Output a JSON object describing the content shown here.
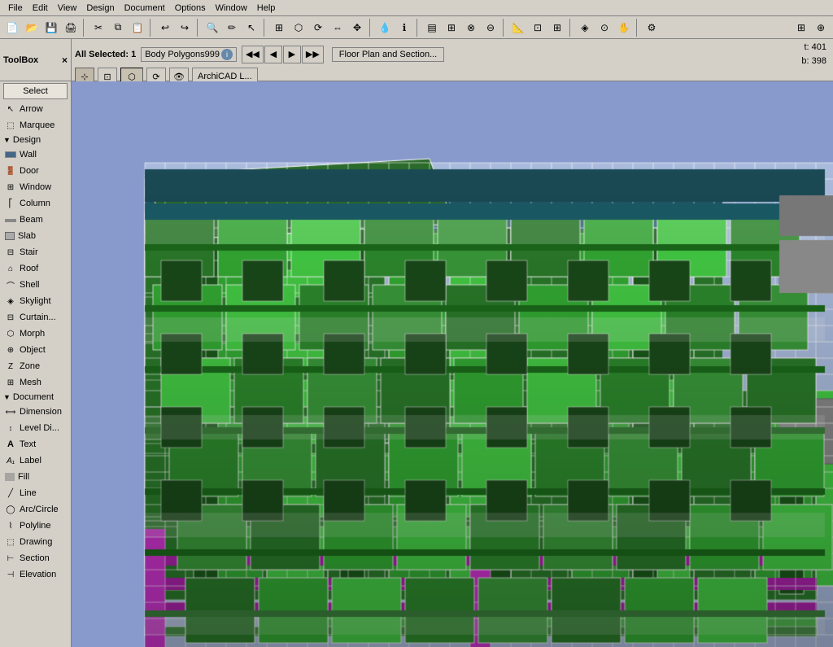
{
  "menu": {
    "items": [
      "File",
      "Edit",
      "View",
      "Design",
      "Document",
      "Options",
      "Window",
      "Help"
    ]
  },
  "toolbar": {
    "buttons": [
      "new",
      "open",
      "save",
      "print",
      "cut",
      "copy",
      "paste",
      "undo",
      "redo",
      "zoom-in",
      "magnify",
      "pencil",
      "pointer",
      "select-box",
      "rotate",
      "mirror",
      "move",
      "stretch",
      "eyedrop",
      "info",
      "layers",
      "group",
      "ungroup",
      "intersect",
      "subtract",
      "add",
      "measure",
      "snap",
      "grid",
      "ortho",
      "view3d",
      "orbit",
      "pan",
      "zoom",
      "fullscreen",
      "settings"
    ]
  },
  "context_bar": {
    "toolbox_label": "ToolBox",
    "close_icon": "×",
    "selection_label": "All Selected: 1",
    "body_polygons_label": "Body Polygons999",
    "info_icon": "i",
    "floor_plan_btn": "Floor Plan and Section...",
    "coords": {
      "t_label": "t:",
      "t_value": "401",
      "b_label": "b:",
      "b_value": "398"
    },
    "nav_buttons": [
      "◀◀",
      "◀",
      "▶",
      "▶▶"
    ],
    "select_btn": "Select",
    "arrow_btn": "Arrow",
    "layer_btn": "ArchiCAD L..."
  },
  "toolbox": {
    "select_label": "Select",
    "arrow_label": "Arrow",
    "marquee_label": "Marquee",
    "design_section": "Design",
    "document_section": "Document",
    "tools": [
      {
        "name": "Wall",
        "icon": "wall"
      },
      {
        "name": "Door",
        "icon": "door"
      },
      {
        "name": "Window",
        "icon": "window"
      },
      {
        "name": "Column",
        "icon": "column"
      },
      {
        "name": "Beam",
        "icon": "beam"
      },
      {
        "name": "Slab",
        "icon": "slab"
      },
      {
        "name": "Stair",
        "icon": "stair"
      },
      {
        "name": "Roof",
        "icon": "roof"
      },
      {
        "name": "Shell",
        "icon": "shell"
      },
      {
        "name": "Skylight",
        "icon": "skylight"
      },
      {
        "name": "Curtain...",
        "icon": "curtain"
      },
      {
        "name": "Morph",
        "icon": "morph"
      },
      {
        "name": "Object",
        "icon": "object"
      },
      {
        "name": "Zone",
        "icon": "zone"
      },
      {
        "name": "Mesh",
        "icon": "mesh"
      }
    ],
    "doc_tools": [
      {
        "name": "Dimension",
        "icon": "dimension"
      },
      {
        "name": "Level Di...",
        "icon": "level"
      },
      {
        "name": "Text",
        "icon": "text"
      },
      {
        "name": "Label",
        "icon": "label"
      },
      {
        "name": "Fill",
        "icon": "fill"
      },
      {
        "name": "Line",
        "icon": "line"
      },
      {
        "name": "Arc/Circle",
        "icon": "arc"
      },
      {
        "name": "Polyline",
        "icon": "polyline"
      },
      {
        "name": "Drawing",
        "icon": "drawing"
      },
      {
        "name": "Section",
        "icon": "section"
      },
      {
        "name": "Elevation",
        "icon": "elevation"
      }
    ]
  },
  "viewport": {
    "background_color": "#8899cc"
  }
}
